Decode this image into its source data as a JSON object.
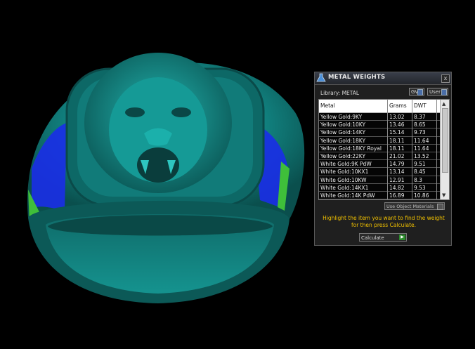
{
  "panel": {
    "title": "METAL WEIGHTS",
    "close": "x",
    "library_label": "Library: METAL",
    "gv_label": "GV",
    "user_label": "User",
    "columns": [
      "Metal",
      "Grams",
      "DWT"
    ],
    "rows": [
      {
        "metal": "Yellow Gold:9KY",
        "grams": "13.02",
        "dwt": "8.37"
      },
      {
        "metal": "Yellow Gold:10KY",
        "grams": "13.46",
        "dwt": "8.65"
      },
      {
        "metal": "Yellow Gold:14KY",
        "grams": "15.14",
        "dwt": "9.73"
      },
      {
        "metal": "Yellow Gold:18KY",
        "grams": "18.11",
        "dwt": "11.64"
      },
      {
        "metal": "Yellow Gold:18KY Royal",
        "grams": "18.11",
        "dwt": "11.64"
      },
      {
        "metal": "Yellow Gold:22KY",
        "grams": "21.02",
        "dwt": "13.52"
      },
      {
        "metal": "White Gold:9K PdW",
        "grams": "14.79",
        "dwt": "9.51"
      },
      {
        "metal": "White Gold:10KX1",
        "grams": "13.14",
        "dwt": "8.45"
      },
      {
        "metal": "White Gold:10KW",
        "grams": "12.91",
        "dwt": "8.3"
      },
      {
        "metal": "White Gold:14KX1",
        "grams": "14.82",
        "dwt": "9.53"
      },
      {
        "metal": "White Gold:14K PdW",
        "grams": "16.89",
        "dwt": "10.86"
      }
    ],
    "use_object_materials": "Use Object Materials",
    "hint": "Highlight the item you want to find the weight for then press Calculate.",
    "calculate": "Calculate"
  },
  "colors": {
    "ring": "#138a88",
    "ring_dark": "#0a4d4c",
    "accent_blue": "#1a2ee8",
    "accent_green": "#3fbf3a",
    "hint_text": "#f0c000"
  }
}
